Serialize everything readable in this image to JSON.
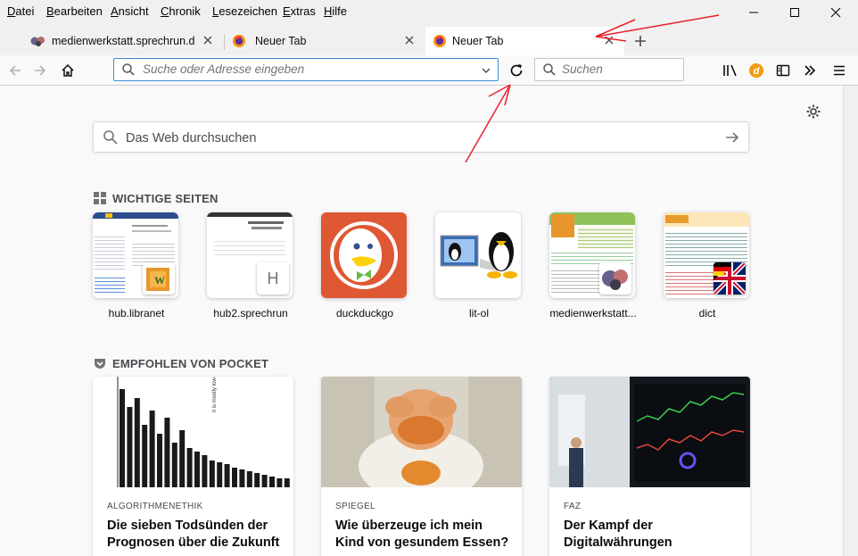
{
  "menu": [
    "Datei",
    "Bearbeiten",
    "Ansicht",
    "Chronik",
    "Lesezeichen",
    "Extras",
    "Hilfe"
  ],
  "tabs": [
    {
      "title": "medienwerkstatt.sprechrun.de",
      "icon": "site-favicon-icon"
    },
    {
      "title": "Neuer Tab",
      "icon": "firefox-icon"
    },
    {
      "title": "Neuer Tab",
      "icon": "firefox-icon",
      "active": true
    }
  ],
  "urlbar": {
    "placeholder": "Suche oder Adresse eingeben"
  },
  "searchbar": {
    "placeholder": "Suchen"
  },
  "newtab": {
    "search_placeholder": "Das Web durchsuchen",
    "top_sites_title": "WICHTIGE SEITEN",
    "pocket_title": "EMPFOHLEN VON POCKET",
    "top_sites": [
      {
        "label": "hub.libranet"
      },
      {
        "label": "hub2.sprechrun"
      },
      {
        "label": "duckduckgo"
      },
      {
        "label": "lit-ol"
      },
      {
        "label": "medienwerkstatt..."
      },
      {
        "label": "dict"
      }
    ],
    "h_badge_letter": "H",
    "cards": [
      {
        "source": "ALGORITHMENETHIK",
        "title": "Die sieben Todsünden der Prognosen über die Zukunft"
      },
      {
        "source": "SPIEGEL",
        "title": "Wie überzeuge ich mein Kind von gesundem Essen?"
      },
      {
        "source": "FAZ",
        "title": "Der Kampf der Digitalwährungen"
      }
    ]
  },
  "colors": {
    "accent": "#0a84ff",
    "annotation": "#e8202a",
    "ddg": "#de5833",
    "chart_bar": "#1a1a1a"
  }
}
